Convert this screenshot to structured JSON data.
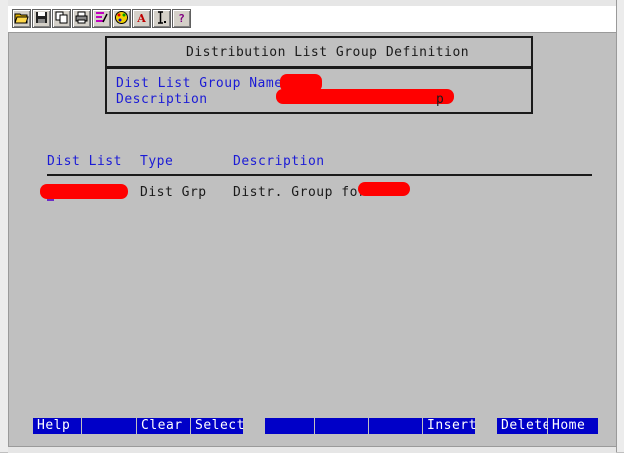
{
  "toolbar": {
    "icons": [
      "folder-open-icon",
      "save-icon",
      "copy-icon",
      "print-icon",
      "edit-icon",
      "palette-icon",
      "font-icon",
      "text-cursor-icon",
      "help-icon"
    ],
    "font_label": "A",
    "help_label": "?"
  },
  "header": {
    "title": "Distribution List Group Definition",
    "name_label": "Dist List Group Name",
    "description_label": "Description",
    "description_tail": "p"
  },
  "table": {
    "columns": [
      "Dist List",
      "Type",
      "Description"
    ],
    "rows": [
      {
        "type": "Dist Grp",
        "description": "Distr. Group for"
      }
    ]
  },
  "function_keys": [
    "Help",
    "",
    "Clear",
    "Select",
    "",
    "",
    "",
    "Insert",
    "Delete",
    "Home"
  ],
  "colors": {
    "background": "#c0c0c0",
    "field_label": "#1b1bd6",
    "text": "#1a1a1a",
    "function_key_bar": "#0000c8",
    "redaction": "#ff0000"
  }
}
